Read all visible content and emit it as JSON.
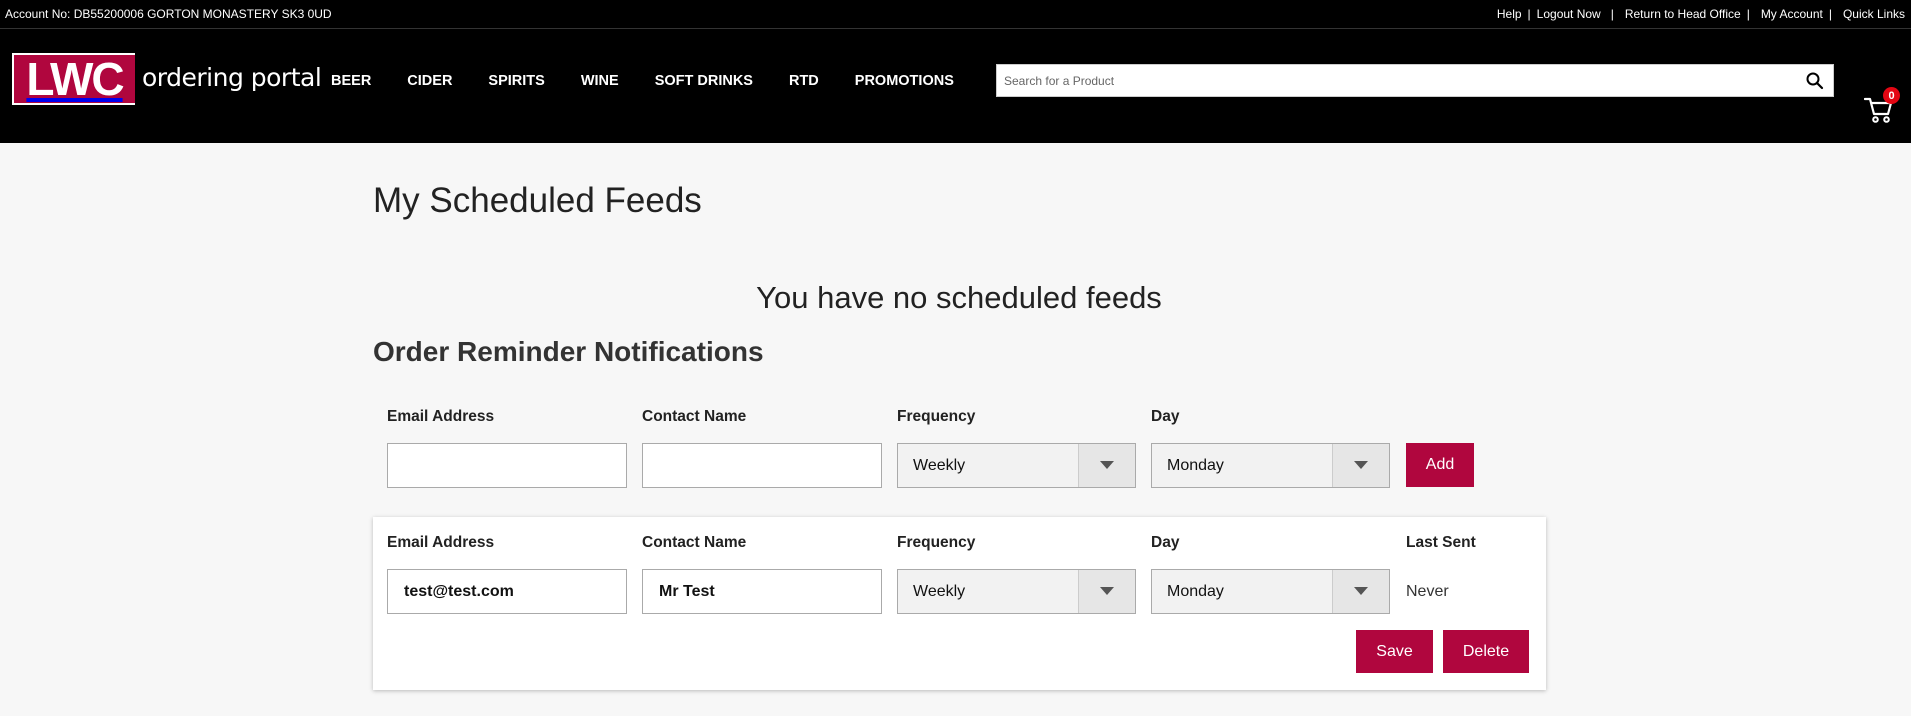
{
  "topbar": {
    "account": "Account No: DB55200006 GORTON MONASTERY SK3 0UD",
    "links": [
      "Help",
      "Logout Now",
      "Return to Head Office",
      "My Account",
      "Quick Links"
    ]
  },
  "header": {
    "logo_text": "LWC",
    "portal_text": "ordering portal",
    "nav": [
      "BEER",
      "CIDER",
      "SPIRITS",
      "WINE",
      "SOFT DRINKS",
      "RTD",
      "PROMOTIONS"
    ],
    "search_placeholder": "Search for a Product",
    "cart_count": "0"
  },
  "main": {
    "page_title": "My Scheduled Feeds",
    "no_feeds_message": "You have no scheduled feeds",
    "section_title": "Order Reminder Notifications",
    "new_row": {
      "email_label": "Email Address",
      "contact_label": "Contact Name",
      "frequency_label": "Frequency",
      "day_label": "Day",
      "email_value": "",
      "contact_value": "",
      "frequency_value": "Weekly",
      "day_value": "Monday",
      "add_label": "Add"
    },
    "existing": {
      "email_label": "Email Address",
      "contact_label": "Contact Name",
      "frequency_label": "Frequency",
      "day_label": "Day",
      "last_sent_label": "Last Sent",
      "email_value": "test@test.com",
      "contact_value": "Mr Test",
      "frequency_value": "Weekly",
      "day_value": "Monday",
      "last_sent_value": "Never",
      "save_label": "Save",
      "delete_label": "Delete"
    }
  },
  "colors": {
    "brand": "#b0063e",
    "header_bg": "#000000",
    "badge": "#e30613"
  },
  "icons": {
    "search": "search-icon",
    "cart": "cart-icon",
    "dropdown": "chevron-down-icon"
  }
}
